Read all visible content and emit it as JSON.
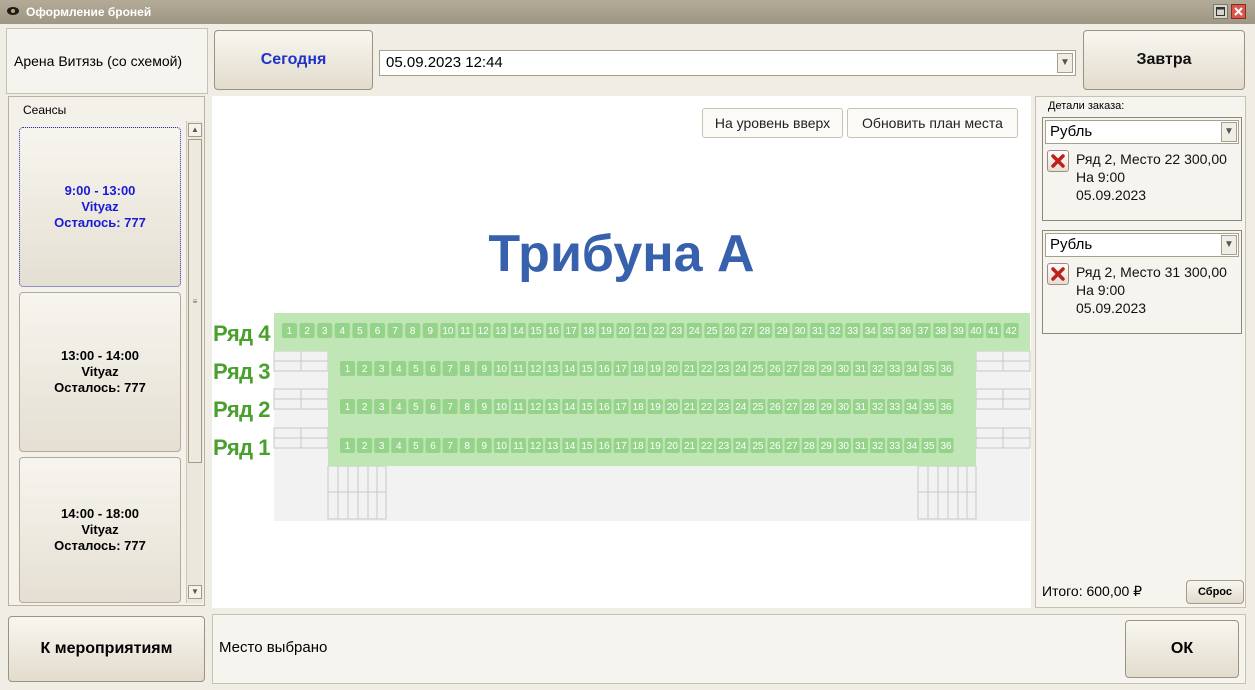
{
  "window": {
    "title": "Оформление броней",
    "title_icon": "eye-icon"
  },
  "venue": "Арена Витязь (со схемой)",
  "nav": {
    "today": "Сегодня",
    "tomorrow": "Завтра",
    "date_value": "05.09.2023 12:44",
    "to_events": "К мероприятиям",
    "ok": "ОК"
  },
  "sessions": {
    "header": "Сеансы",
    "items": [
      {
        "time": "9:00 - 13:00",
        "name": "Vityaz",
        "remaining": "Осталось: 777",
        "selected": true
      },
      {
        "time": "13:00 - 14:00",
        "name": "Vityaz",
        "remaining": "Осталось: 777",
        "selected": false
      },
      {
        "time": "14:00 - 18:00",
        "name": "Vityaz",
        "remaining": "Осталось: 777",
        "selected": false
      }
    ]
  },
  "plan": {
    "up_button": "На уровень вверх",
    "refresh_button": "Обновить план места",
    "tribune_title": "Трибуна А",
    "row_labels": [
      "Ряд 4",
      "Ряд 3",
      "Ряд 2",
      "Ряд 1"
    ],
    "row_seat_counts": [
      42,
      36,
      36,
      36
    ],
    "colors": {
      "seat": "#96d38a",
      "seat_row_bg": "#bfe6b4",
      "seat_text": "#ffffff",
      "row_label": "#49a02d",
      "tribune": "#3760ad"
    }
  },
  "order": {
    "header": "Детали заказа:",
    "items": [
      {
        "currency": "Рубль",
        "line1": "Ряд 2, Место 22 300,00",
        "line2": "На 9:00",
        "line3": "05.09.2023"
      },
      {
        "currency": "Рубль",
        "line1": "Ряд 2, Место 31 300,00",
        "line2": "На 9:00",
        "line3": "05.09.2023"
      }
    ],
    "total": "Итого: 600,00 ₽",
    "reset": "Сброс"
  },
  "status": "Место выбрано"
}
